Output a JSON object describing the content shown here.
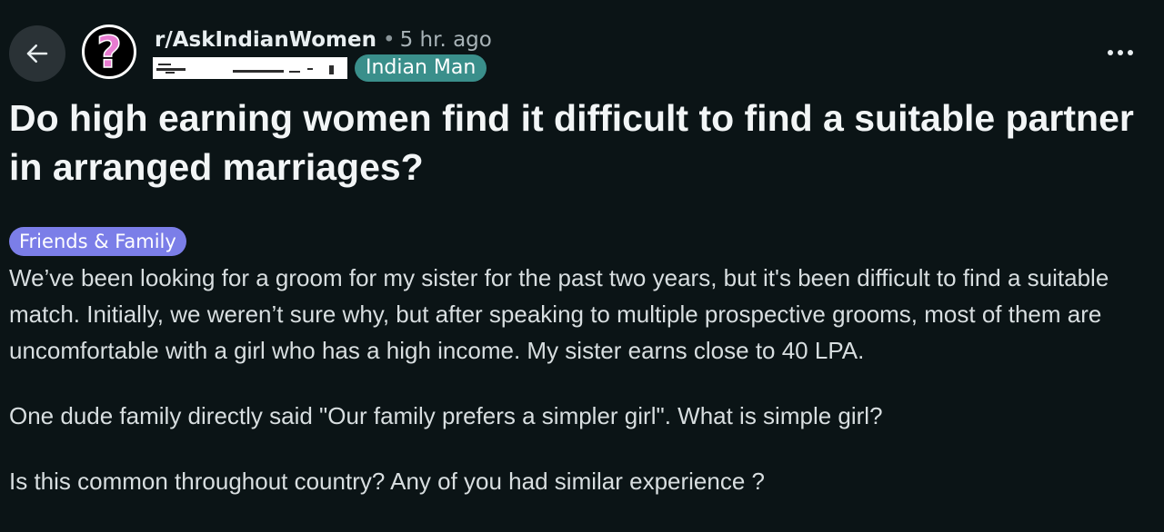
{
  "header": {
    "back_icon": "arrow-left-icon",
    "avatar_icon": "question-mark-icon",
    "subreddit": "r/AskIndianWomen",
    "separator": "•",
    "timestamp": "5 hr. ago",
    "username_redacted": true,
    "user_flair": "Indian Man",
    "overflow_icon": "more-horizontal-icon"
  },
  "post": {
    "title": "Do high earning women find it difficult to find a suitable partner in arranged marriages?",
    "flair": "Friends & Family",
    "paragraphs": [
      "We’ve been looking for a groom for my sister for the past two years, but it's been difficult to find a suitable match. Initially, we weren’t sure why, but after speaking to multiple prospective grooms, most of them are uncomfortable with a girl who has a high income. My sister earns close to 40 LPA.",
      "One dude family directly said \"Our family prefers a simpler girl\". What is simple girl?",
      "Is this common throughout country? Any of you had similar experience ?"
    ]
  },
  "colors": {
    "background": "#0b1416",
    "user_flair_bg": "#3a8f8b",
    "post_flair_bg": "#7b7ee8",
    "avatar_glyph": "#e87bd0"
  }
}
